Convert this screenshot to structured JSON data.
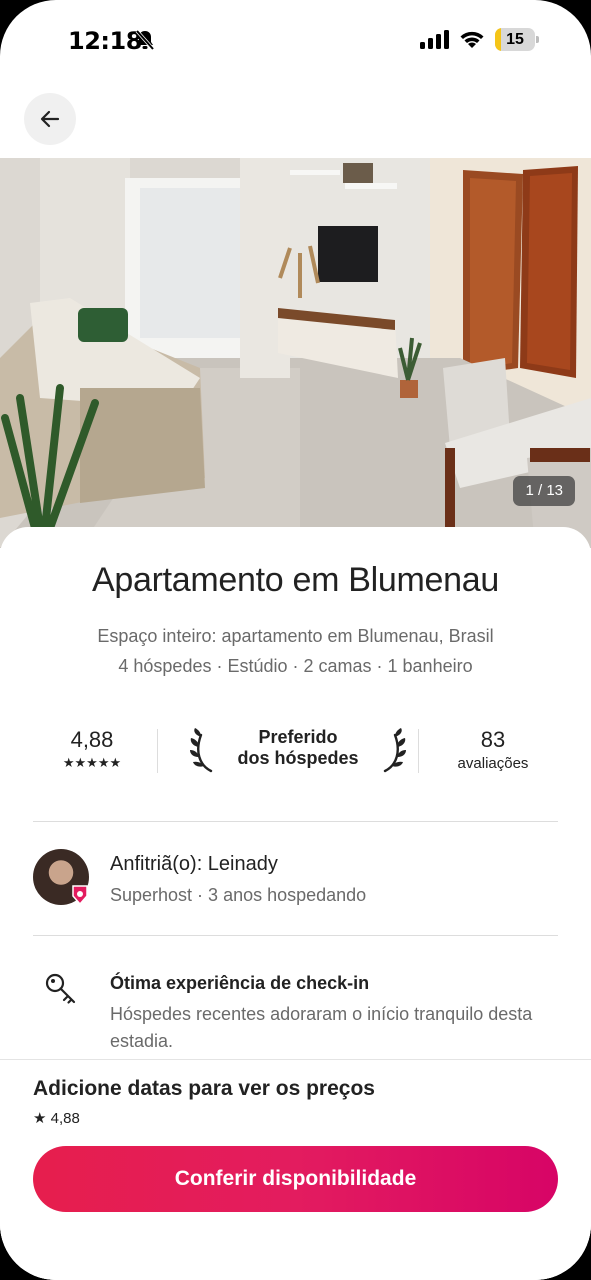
{
  "status_bar": {
    "time": "12:18",
    "battery": "15",
    "battery_level": 0.15
  },
  "gallery": {
    "counter": "1 / 13"
  },
  "listing": {
    "title": "Apartamento em Blumenau",
    "subtitle": "Espaço inteiro: apartamento em Blumenau, Brasil",
    "details": "4 hóspedes · Estúdio · 2 camas · 1 banheiro"
  },
  "stats": {
    "rating": "4,88",
    "stars": "★★★★★",
    "favorite_line1": "Preferido",
    "favorite_line2": "dos hóspedes",
    "reviews_count": "83",
    "reviews_label": "avaliações"
  },
  "host": {
    "name": "Anfitriã(o): Leinady",
    "meta": "Superhost · 3 anos hospedando"
  },
  "highlight": {
    "icon": "key-icon",
    "title": "Ótima experiência de check-in",
    "description": "Hóspedes recentes adoraram o início tranquilo desta estadia."
  },
  "footer": {
    "prompt": "Adicione datas para ver os preços",
    "rating": "4,88",
    "cta": "Conferir disponibilidade"
  },
  "colors": {
    "brand": "#e31c5f",
    "text": "#222222",
    "muted": "#6a6a6a"
  }
}
